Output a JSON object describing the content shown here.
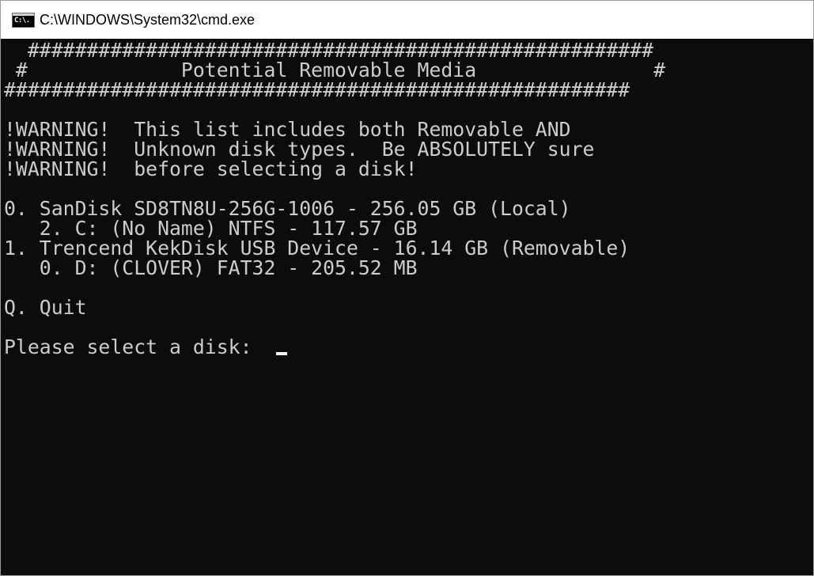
{
  "window": {
    "title": "C:\\WINDOWS\\System32\\cmd.exe",
    "icon": "cmd-console-icon",
    "icon_glyph": "C:\\."
  },
  "console": {
    "foreground": "#cccccc",
    "background": "#0c0c0c",
    "lines": [
      "  #####################################################",
      " #             Potential Removable Media               #",
      "#####################################################",
      "",
      "!WARNING!  This list includes both Removable AND",
      "!WARNING!  Unknown disk types.  Be ABSOLUTELY sure",
      "!WARNING!  before selecting a disk!",
      "",
      "0. SanDisk SD8TN8U-256G-1006 - 256.05 GB (Local)",
      "   2. C: (No Name) NTFS - 117.57 GB",
      "1. Trencend KekDisk USB Device - 16.14 GB (Removable)",
      "   0. D: (CLOVER) FAT32 - 205.52 MB",
      "",
      "Q. Quit",
      "",
      "Please select a disk:  "
    ]
  }
}
